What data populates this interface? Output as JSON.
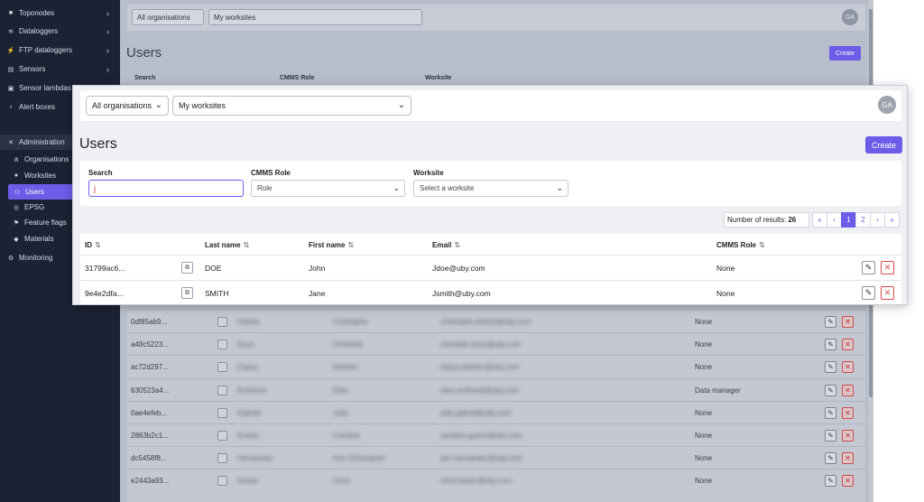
{
  "sidebar": {
    "items": [
      {
        "label": "Toponodes",
        "icon": "camera-icon"
      },
      {
        "label": "Dataloggers",
        "icon": "wifi-icon"
      },
      {
        "label": "FTP dataloggers",
        "icon": "plug-icon"
      },
      {
        "label": "Sensors",
        "icon": "server-icon"
      },
      {
        "label": "Sensor lambdas",
        "icon": "chip-icon"
      },
      {
        "label": "Alert boxes",
        "icon": "bell-icon"
      }
    ],
    "admin": {
      "label": "Administration",
      "icon": "tools-icon"
    },
    "admin_items": [
      {
        "label": "Organisations",
        "icon": "hierarchy-icon"
      },
      {
        "label": "Worksites",
        "icon": "pin-icon"
      },
      {
        "label": "Users",
        "icon": "users-icon"
      },
      {
        "label": "EPSG",
        "icon": "globe-icon"
      },
      {
        "label": "Feature flags",
        "icon": "flag-icon"
      },
      {
        "label": "Materials",
        "icon": "cube-icon"
      }
    ],
    "monitoring": {
      "label": "Monitoring",
      "icon": "gear-icon"
    }
  },
  "topbar": {
    "org_select": "All organisations",
    "worksite_select": "My worksites",
    "avatar": "GA"
  },
  "page": {
    "title": "Users",
    "create_label": "Create"
  },
  "filters": {
    "search_label": "Search",
    "search_value": "j",
    "role_label": "CMMS Role",
    "role_placeholder": "Role",
    "worksite_label": "Worksite",
    "worksite_placeholder": "Select a worksite"
  },
  "results": {
    "label": "Number of results:",
    "count": "26"
  },
  "pagination": {
    "first": "«",
    "prev": "‹",
    "pages": [
      "1",
      "2"
    ],
    "current": "1",
    "next": "›",
    "last": "»"
  },
  "table": {
    "columns": [
      "ID",
      "Last name",
      "First name",
      "Email",
      "CMMS Role"
    ],
    "sort_icon": "⇅",
    "rows": [
      {
        "id": "31799ac6...",
        "last": "DOE",
        "first": "John",
        "email": "Jdoe@uby.com",
        "role": "None"
      },
      {
        "id": "9e4e2dfa...",
        "last": "SMITH",
        "first": "Jane",
        "email": "Jsmith@uby.com",
        "role": "None"
      }
    ]
  },
  "background_table": {
    "rows": [
      {
        "id": "0df85ab9...",
        "last": "Dubois",
        "first": "Christophe",
        "email": "christophe.dubois@uby.com",
        "role": "None"
      },
      {
        "id": "a48c5223...",
        "last": "Dunn",
        "first": "Christelle",
        "email": "christelle.dunn@uby.com",
        "role": "None"
      },
      {
        "id": "ac72d297...",
        "last": "Dupuy",
        "first": "Damien",
        "email": "dupuy.damien@uby.com",
        "role": "None"
      },
      {
        "id": "630523a4...",
        "last": "Eckhardt",
        "first": "Elise",
        "email": "elise.eckhardt@uby.com",
        "role": "Data manager"
      },
      {
        "id": "0ae4efeb...",
        "last": "Gabriel",
        "first": "Julie",
        "email": "julie.gabriel@uby.com",
        "role": "None"
      },
      {
        "id": "2863b2c1...",
        "last": "Guerin",
        "first": "Caroline",
        "email": "caroline.guerin@uby.com",
        "role": "None"
      },
      {
        "id": "dc5458f8...",
        "last": "Hernandez",
        "first": "Ann Christopher",
        "email": "ann.hernandez@uby.com",
        "role": "None"
      },
      {
        "id": "e2443a93...",
        "last": "Hester",
        "first": "Chris",
        "email": "chris.hester@uby.com",
        "role": "None"
      }
    ]
  },
  "colors": {
    "accent": "#6c5ce7",
    "sidebar_bg": "#1b2233",
    "danger": "#e04848"
  }
}
